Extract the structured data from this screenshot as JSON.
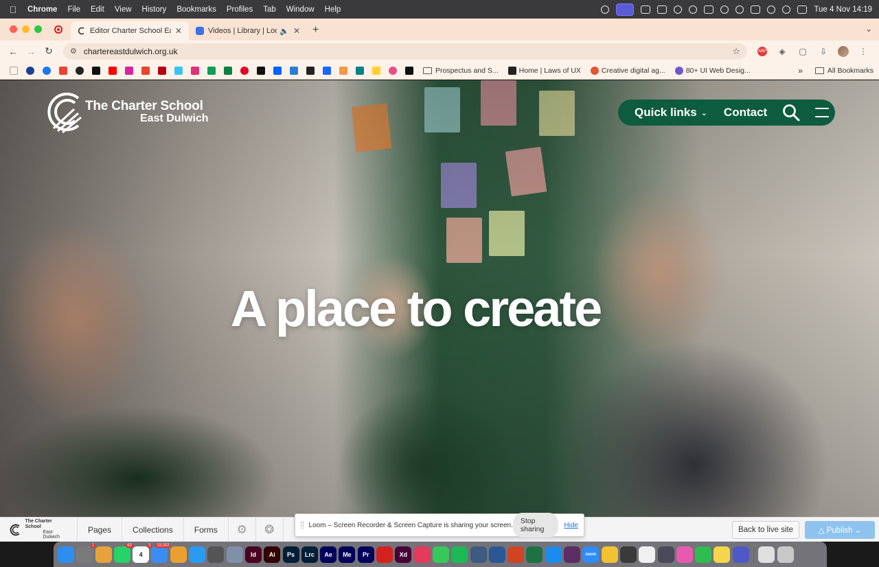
{
  "menubar": {
    "app_name": "Chrome",
    "items": [
      "File",
      "Edit",
      "View",
      "History",
      "Bookmarks",
      "Profiles",
      "Tab",
      "Window",
      "Help"
    ],
    "clock": "Tue 4 Nov  14:19"
  },
  "tabs": [
    {
      "title": "Editor Charter School East Dulwich",
      "active": true
    },
    {
      "title": "Videos | Library | Loom",
      "active": false
    }
  ],
  "toolbar": {
    "url": "chartereastdulwich.org.uk"
  },
  "bookmarks": {
    "links": [
      {
        "label": "Prospectus and S...",
        "color": "#c7a15a"
      },
      {
        "label": "Home | Laws of UX",
        "color": "#222222"
      },
      {
        "label": "Creative digital ag...",
        "color": "#e4572e"
      },
      {
        "label": "80+ UI Web Desig...",
        "color": "#6a5acd"
      }
    ],
    "all_label": "All Bookmarks"
  },
  "site": {
    "logo_line1": "The Charter School",
    "logo_line2": "East Dulwich",
    "nav_quick_links": "Quick links",
    "nav_contact": "Contact",
    "headline": "A place to create",
    "brand_color": "#0d5c3f"
  },
  "cms": {
    "logo_line1": "The Charter School",
    "logo_line2": "East Dulwich",
    "tabs": [
      "Pages",
      "Collections",
      "Forms"
    ],
    "back_to_live": "Back to live site",
    "publish": "Publish"
  },
  "loom": {
    "message": "Loom – Screen Recorder & Screen Capture is sharing your screen.",
    "stop": "Stop sharing",
    "hide": "Hide"
  },
  "dock": {
    "apps": [
      {
        "name": "finder",
        "label": "",
        "color": "#2c8ff0"
      },
      {
        "name": "system-settings",
        "label": "",
        "color": "#7a7a7a",
        "badge": "1"
      },
      {
        "name": "launchpad",
        "label": "",
        "color": "#e8a23c"
      },
      {
        "name": "whatsapp",
        "label": "",
        "color": "#25d366",
        "badge": "63"
      },
      {
        "name": "calendar",
        "label": "4",
        "color": "#ffffff",
        "badge": "3"
      },
      {
        "name": "mail",
        "label": "",
        "color": "#3b8ef0",
        "badge": "18,502"
      },
      {
        "name": "chrome",
        "label": "",
        "color": "#e9a030"
      },
      {
        "name": "safari",
        "label": "",
        "color": "#2a9af0"
      },
      {
        "name": "chatgpt",
        "label": "",
        "color": "#555555"
      },
      {
        "name": "preview",
        "label": "",
        "color": "#8090a8"
      },
      {
        "name": "indesign",
        "label": "Id",
        "color": "#49021f"
      },
      {
        "name": "illustrator",
        "label": "Ai",
        "color": "#330000"
      },
      {
        "name": "photoshop",
        "label": "Ps",
        "color": "#001e36"
      },
      {
        "name": "lightroom-classic",
        "label": "Lrc",
        "color": "#001e36"
      },
      {
        "name": "after-effects",
        "label": "Ae",
        "color": "#00005b"
      },
      {
        "name": "media-encoder",
        "label": "Me",
        "color": "#00005b"
      },
      {
        "name": "premiere",
        "label": "Pr",
        "color": "#00005b"
      },
      {
        "name": "acrobat",
        "label": "",
        "color": "#d4201e"
      },
      {
        "name": "xd",
        "label": "Xd",
        "color": "#470137"
      },
      {
        "name": "creative-cloud",
        "label": "",
        "color": "#e43a5c"
      },
      {
        "name": "messages",
        "label": "",
        "color": "#36c85a"
      },
      {
        "name": "spotify",
        "label": "",
        "color": "#1db954"
      },
      {
        "name": "vpn",
        "label": "",
        "color": "#3d5a80"
      },
      {
        "name": "word",
        "label": "",
        "color": "#2b5797"
      },
      {
        "name": "powerpoint",
        "label": "",
        "color": "#d04423"
      },
      {
        "name": "excel",
        "label": "",
        "color": "#1e7145"
      },
      {
        "name": "app-store",
        "label": "",
        "color": "#1c8bf0"
      },
      {
        "name": "slack",
        "label": "",
        "color": "#5b2d63"
      },
      {
        "name": "zoom",
        "label": "zoom",
        "color": "#2d8cff"
      },
      {
        "name": "pineapple",
        "label": "",
        "color": "#f2c230"
      },
      {
        "name": "calculator",
        "label": "",
        "color": "#3a3a3a"
      },
      {
        "name": "textedit",
        "label": "",
        "color": "#f0f0f0"
      },
      {
        "name": "screenshot",
        "label": "",
        "color": "#4a4a5a"
      },
      {
        "name": "arc",
        "label": "",
        "color": "#e85ab0"
      },
      {
        "name": "numbers",
        "label": "",
        "color": "#2ebd4e"
      },
      {
        "name": "notes",
        "label": "",
        "color": "#f5d54c"
      },
      {
        "name": "teams",
        "label": "",
        "color": "#5058c8"
      },
      {
        "name": "documents-folder",
        "label": "",
        "color": "#e0e0e0"
      },
      {
        "name": "trash",
        "label": "",
        "color": "#c8c8c8"
      }
    ]
  }
}
